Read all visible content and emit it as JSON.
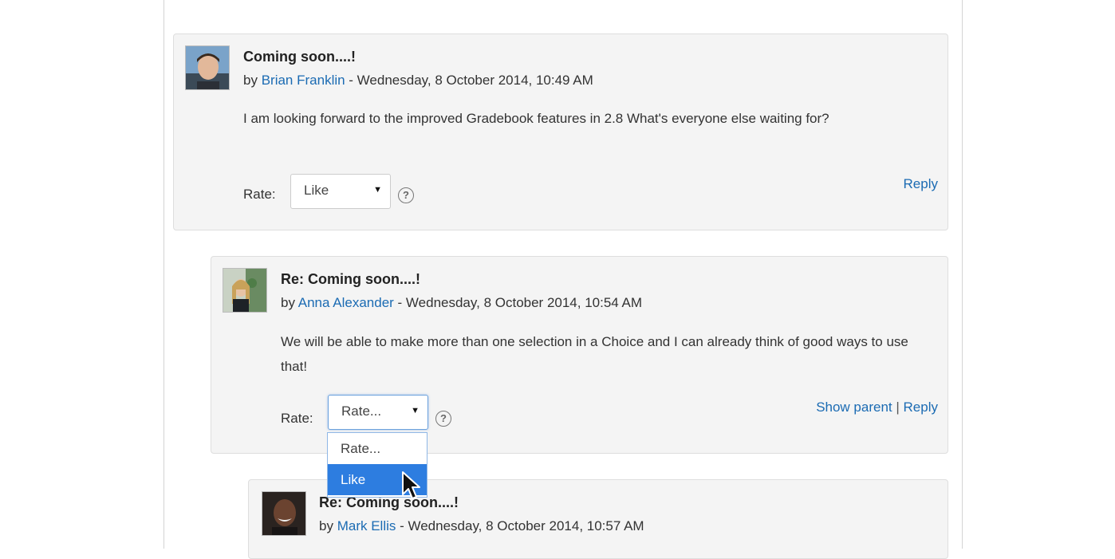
{
  "posts": [
    {
      "subject": "Coming soon....!",
      "by": "by",
      "author": "Brian Franklin",
      "date": " - Wednesday, 8 October 2014, 10:49 AM",
      "message": "I am looking forward to the improved Gradebook features in 2.8 What's everyone else waiting for?",
      "rate_label": "Rate:",
      "rate_value": "Like",
      "reply": "Reply"
    },
    {
      "subject": "Re: Coming soon....!",
      "by": "by",
      "author": "Anna Alexander",
      "date": " - Wednesday, 8 October 2014, 10:54 AM",
      "message": "We will be able to make more than one selection in a Choice and I can already think of good ways to use that!",
      "rate_label": "Rate:",
      "rate_value": "Rate...",
      "show_parent": "Show parent",
      "separator": "|",
      "reply": "Reply",
      "dropdown_options": [
        "Rate...",
        "Like"
      ],
      "dropdown_highlighted": "Like"
    },
    {
      "subject": "Re: Coming soon....!",
      "by": "by",
      "author": "Mark Ellis",
      "date": " - Wednesday, 8 October 2014, 10:57 AM"
    }
  ],
  "icons": {
    "help": "?",
    "dropdown_arrow": "▼"
  },
  "colors": {
    "link": "#1b6bb3",
    "highlight": "#2d7de0",
    "post_bg": "#f4f4f4"
  }
}
